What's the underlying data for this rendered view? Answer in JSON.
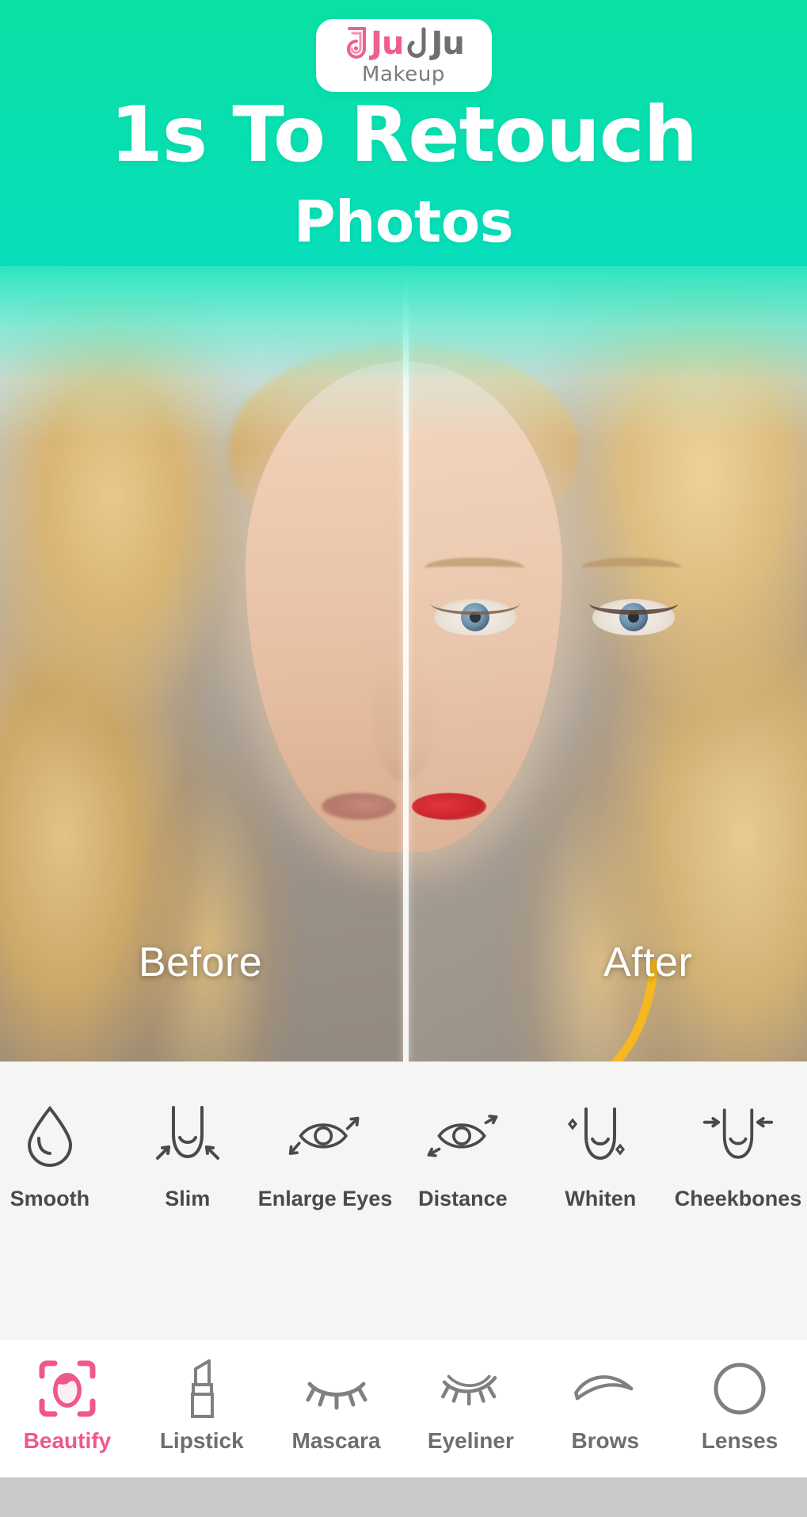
{
  "app": {
    "brand_primary": "Ju",
    "brand_secondary": "Ju",
    "brand_subtitle": "Makeup",
    "accent_pink": "#ef5f8c",
    "accent_mint": "#0ae0a4",
    "nav_active_color": "#f0578c",
    "jawline_guide_color": "#f5b81e"
  },
  "hero": {
    "headline_line1": "1s To Retouch",
    "headline_line2": "Photos",
    "before_label": "Before",
    "after_label": "After"
  },
  "tools": {
    "items": [
      {
        "label": "Smooth",
        "icon": "droplet-icon"
      },
      {
        "label": "Slim",
        "icon": "face-slim-icon"
      },
      {
        "label": "Enlarge Eyes",
        "icon": "eye-enlarge-icon"
      },
      {
        "label": "Distance",
        "icon": "eye-distance-icon"
      },
      {
        "label": "Whiten",
        "icon": "face-sparkle-icon"
      },
      {
        "label": "Cheekbones",
        "icon": "face-cheekbones-icon"
      }
    ]
  },
  "nav": {
    "items": [
      {
        "label": "Beautify",
        "icon": "face-scan-icon",
        "active": true
      },
      {
        "label": "Lipstick",
        "icon": "lipstick-icon",
        "active": false
      },
      {
        "label": "Mascara",
        "icon": "lashes-icon",
        "active": false
      },
      {
        "label": "Eyeliner",
        "icon": "eyeliner-icon",
        "active": false
      },
      {
        "label": "Brows",
        "icon": "eyebrow-icon",
        "active": false
      },
      {
        "label": "Lenses",
        "icon": "lens-circle-icon",
        "active": false
      }
    ]
  }
}
